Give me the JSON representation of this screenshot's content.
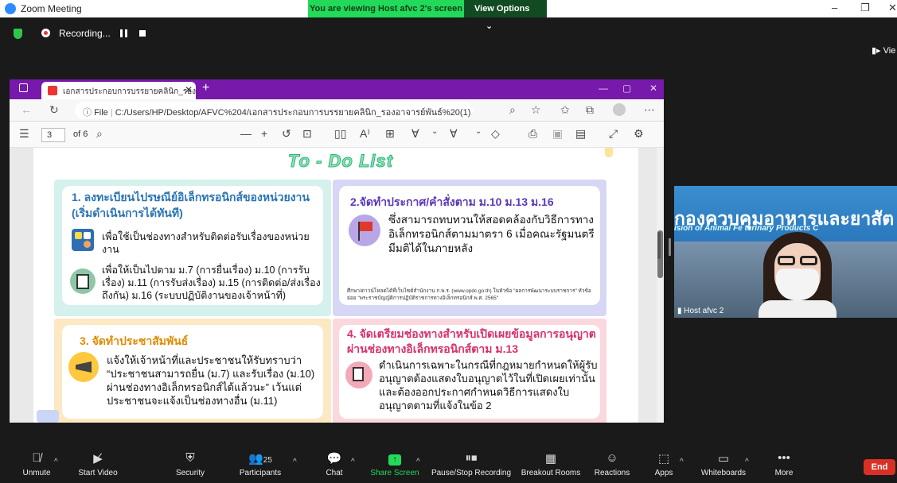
{
  "zoom": {
    "window_title": "Zoom Meeting",
    "viewing_banner": "You are viewing Host afvc 2's screen",
    "view_options": "View Options",
    "recording_label": "Recording...",
    "view_button": "Vie",
    "win_min": "–",
    "win_max": "❐",
    "win_close": "✕"
  },
  "browser": {
    "tab_title": "เอกสารประกอบการบรรยายคลินิก_รอง",
    "address_prefix": "File",
    "address_url": "C:/Users/HP/Desktop/AFVC%204/เอกสารประกอบการบรรยายคลินิก_รองอาจารย์พันธ์%20(1).pdf",
    "page_current": "3",
    "page_total": "of 6"
  },
  "doc": {
    "title": "To - Do List",
    "q1_heading": "1. ลงทะเบียนไปรษณีย์อิเล็กทรอนิกส์ของหน่วยงาน (เริ่มดำเนินการได้ทันที)",
    "q1_item1": "เพื่อใช้เป็นช่องทางสำหรับติดต่อรับเรื่องของหน่วยงาน",
    "q1_item2": "เพื่อให้เป็นไปตาม ม.7 (การยื่นเรื่อง) ม.10 (การรับเรื่อง) ม.11 (การรับส่งเรื่อง) ม.15 (การติดต่อ/ส่งเรื่องถึงกัน) ม.16 (ระบบปฏิบัติงานของเจ้าหน้าที่)",
    "q2_heading": "2.จัดทำประกาศ/คำสั่งตาม ม.10 ม.13 ม.16",
    "q2_body": "ซึ่งสามารถทบทวนให้สอดคล้องกับวิธีการทางอิเล็กทรอนิกส์ตามมาตรา 6 เมื่อคณะรัฐมนตรีมีมติได้ในภายหลัง",
    "q2_note": "ศึกษา/ดาวน์โหลดได้ที่เว็บไซต์สำนักงาน ก.พ.ร. (www.opdc.go.th) ในหัวข้อ \"ผลการพัฒนาระบบราชการ\" หัวข้อย่อย \"พระราชบัญญัติการปฏิบัติราชการทางอิเล็กทรอนิกส์ พ.ศ. 2565\"",
    "q3_heading": "3. จัดทำประชาสัมพันธ์",
    "q3_body": "แจ้งให้เจ้าหน้าที่และประชาชนให้รับทราบว่า “ประชาชนสามารถยื่น (ม.7) และรับเรื่อง (ม.10) ผ่านช่องทางอิเล็กทรอนิกส์ได้แล้วนะ” เว้นแต่ประชาชนจะแจ้งเป็นช่องทางอื่น (ม.11)",
    "q4_heading": "4. จัดเตรียมช่องทางสำหรับเปิดเผยข้อมูลการอนุญาตผ่านช่องทางอิเล็กทรอนิกส์ตาม ม.13",
    "q4_body": "ดำเนินการเฉพาะในกรณีที่กฎหมายกำหนดให้ผู้รับอนุญาตต้องแสดงใบอนุญาตไว้ในที่เปิดเผยเท่านั้น และต้องออกประกาศกำหนดวิธีการแสดงใบอนุญาตตามที่แจ้งในข้อ 2"
  },
  "video": {
    "banner": "กองควบคุมอาหารและยาสัต",
    "subtitle": "ision of Animal Fe      terinary Products C",
    "participant": "Host afvc 2"
  },
  "toolbar": {
    "unmute": "Unmute",
    "start_video": "Start Video",
    "security": "Security",
    "participants": "Participants",
    "participants_count": "25",
    "chat": "Chat",
    "share_screen": "Share Screen",
    "pause_recording": "Pause/Stop Recording",
    "breakout": "Breakout Rooms",
    "reactions": "Reactions",
    "apps": "Apps",
    "whiteboards": "Whiteboards",
    "more": "More",
    "end": "End"
  },
  "colors": {
    "zoom_green": "#23d959",
    "edge_purple": "#7719aa",
    "end_red": "#d93025"
  }
}
